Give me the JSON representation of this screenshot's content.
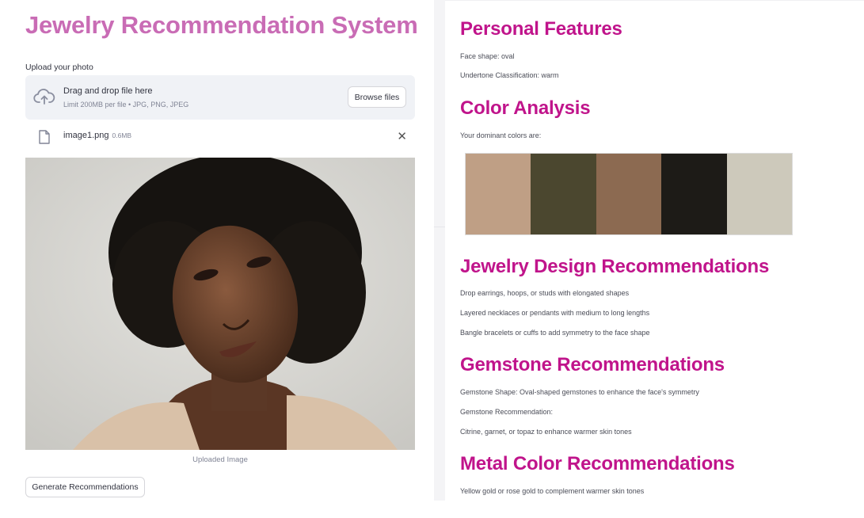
{
  "app": {
    "title": "Jewelry Recommendation System"
  },
  "uploader": {
    "label": "Upload your photo",
    "drop_title": "Drag and drop file here",
    "drop_subtitle": "Limit 200MB per file • JPG, PNG, JPEG",
    "browse_label": "Browse files",
    "file_name": "image1.png",
    "file_size": "0.6MB",
    "remove_icon": "close-icon"
  },
  "image": {
    "caption": "Uploaded Image"
  },
  "actions": {
    "generate_label": "Generate Recommendations"
  },
  "results": {
    "personal": {
      "heading": "Personal Features",
      "face_shape": "Face shape: oval",
      "undertone": "Undertone Classification: warm"
    },
    "color": {
      "heading": "Color Analysis",
      "intro": "Your dominant colors are:",
      "swatches": [
        "#bf9f85",
        "#4b472f",
        "#8c6a51",
        "#1d1b17",
        "#cdc9bb"
      ]
    },
    "design": {
      "heading": "Jewelry Design Recommendations",
      "items": [
        "Drop earrings, hoops, or studs with elongated shapes",
        "Layered necklaces or pendants with medium to long lengths",
        "Bangle bracelets or cuffs to add symmetry to the face shape"
      ]
    },
    "gemstone": {
      "heading": "Gemstone Recommendations",
      "shape": "Gemstone Shape: Oval-shaped gemstones to enhance the face's symmetry",
      "label": "Gemstone Recommendation:",
      "recommendation": "Citrine, garnet, or topaz to enhance warmer skin tones"
    },
    "metal": {
      "heading": "Metal Color Recommendations",
      "recommendation": "Yellow gold or rose gold to complement warmer skin tones"
    }
  },
  "colors": {
    "title": "#c96cb5",
    "heading": "#c0148b",
    "dropzone_bg": "#f0f2f6"
  }
}
